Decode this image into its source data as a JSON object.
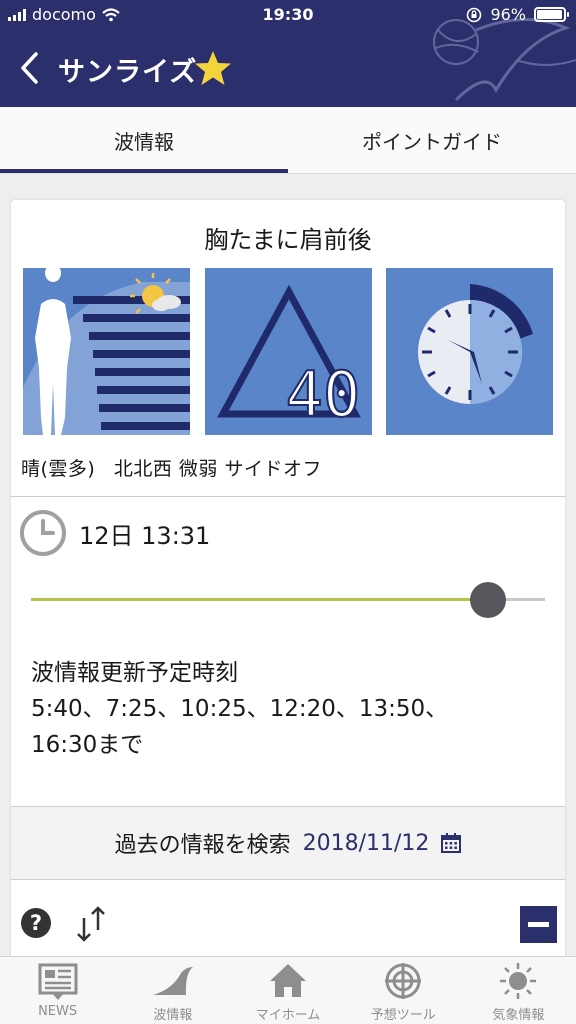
{
  "status_bar": {
    "carrier": "docomo",
    "time": "19:30",
    "battery": "96%",
    "battery_level": 0.96
  },
  "header": {
    "title": "サンライズ"
  },
  "tabs": [
    {
      "label": "波情報",
      "active": true
    },
    {
      "label": "ポイントガイド",
      "active": false
    }
  ],
  "wave": {
    "size": "胸たまに肩前後",
    "quality_score": "40"
  },
  "conditions": {
    "weather": "晴(雲多)",
    "wind": "北北西 微弱 サイドオフ"
  },
  "time_slider": {
    "datetime": "12日 13:31",
    "position": 0.89
  },
  "update_schedule": {
    "label": "波情報更新予定時刻",
    "line1": "5:40、7:25、10:25、12:20、13:50、",
    "line2": "16:30まで"
  },
  "history_search": {
    "label": "過去の情報を検索",
    "date": "2018/11/12"
  },
  "toolbar": {
    "help_symbol": "?"
  },
  "bottom_nav": [
    {
      "label": "NEWS",
      "icon": "news-icon"
    },
    {
      "label": "波情報",
      "icon": "wave-icon"
    },
    {
      "label": "マイホーム",
      "icon": "home-icon"
    },
    {
      "label": "予想ツール",
      "icon": "target-icon"
    },
    {
      "label": "気象情報",
      "icon": "sun-icon"
    }
  ],
  "colors": {
    "header_bg": "#2b2f6b",
    "tile_bg": "#5a85c8",
    "star": "#f2d43b",
    "slider_fill": "#b7c44a"
  }
}
